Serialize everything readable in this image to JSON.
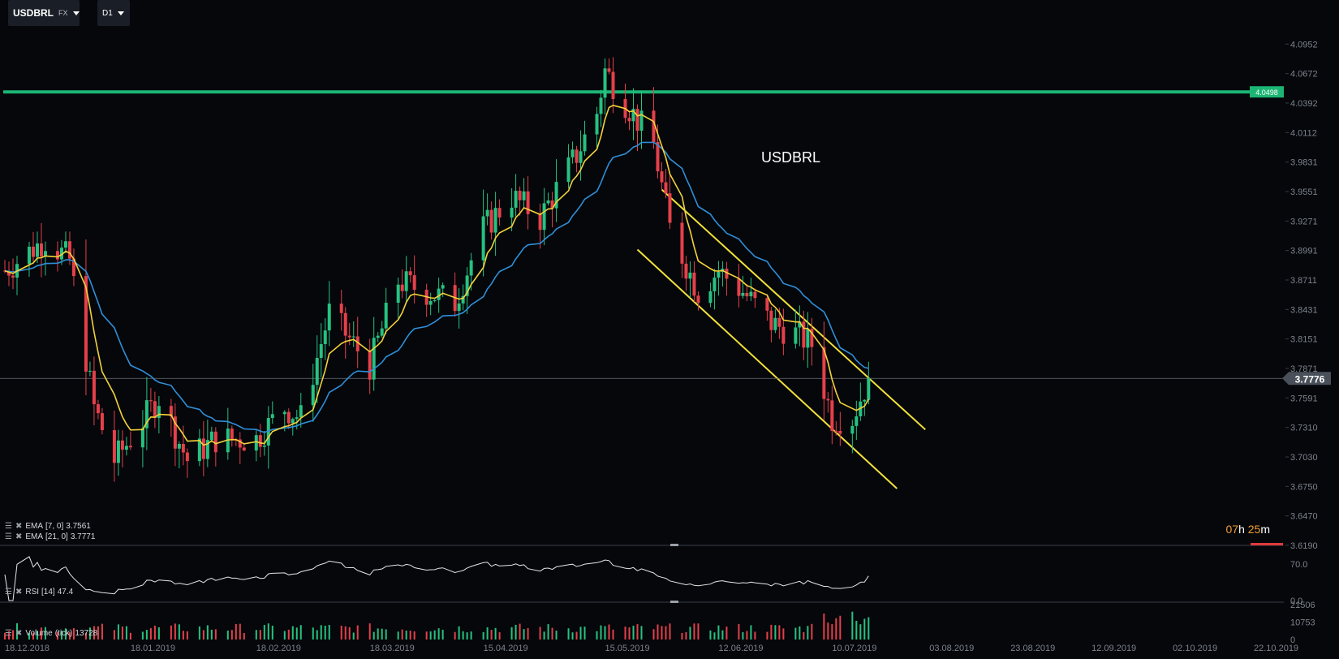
{
  "toolbar": {
    "symbol": "USDBRL",
    "market": "FX",
    "timeframe": "D1"
  },
  "chart_title": "USDBRL",
  "legends": {
    "ema7": {
      "label": "EMA",
      "params": "[7, 0]",
      "value": "3.7561"
    },
    "ema21": {
      "label": "EMA",
      "params": "[21, 0]",
      "value": "3.7771"
    },
    "rsi": {
      "label": "RSI",
      "params": "[14]",
      "value": "47.4"
    },
    "volume": {
      "label": "Volume",
      "params": "(tick)",
      "value": "13728"
    }
  },
  "countdown": {
    "hours": "07",
    "h_unit": "h",
    "minutes": "25",
    "m_unit": "m"
  },
  "colors": {
    "background": "#05070b",
    "bull": "#26c281",
    "bear": "#e5404a",
    "ema7": "#f3d23a",
    "ema21": "#2f8fd8",
    "channel": "#f3e23a",
    "resistance": "#1cb574",
    "grid_text": "#7d838c",
    "rsi_line": "#e6e6e6"
  },
  "chart_data": [
    {
      "type": "candlestick",
      "title": "USDBRL",
      "x_ticks": [
        "18.12.2018",
        "18.01.2019",
        "18.02.2019",
        "18.03.2019",
        "15.04.2019",
        "15.05.2019",
        "12.06.2019",
        "10.07.2019",
        "03.08.2019",
        "23.08.2019",
        "12.09.2019",
        "02.10.2019",
        "22.10.2019"
      ],
      "y_ticks": [
        "4.0952",
        "4.0672",
        "4.0392",
        "4.0112",
        "3.9831",
        "3.9551",
        "3.9271",
        "3.8991",
        "3.8711",
        "3.8431",
        "3.8151",
        "3.7871",
        "3.7591",
        "3.7310",
        "3.7030",
        "3.6750",
        "3.6470",
        "3.6190"
      ],
      "ylim": [
        3.619,
        4.1232
      ],
      "last_price": "3.7776",
      "resistance_level": "4.0498",
      "close_anchors": [
        [
          "18.12.2018",
          3.88
        ],
        [
          "28.12.2018",
          3.91
        ],
        [
          "03.01.2019",
          3.89
        ],
        [
          "09.01.2019",
          3.75
        ],
        [
          "14.01.2019",
          3.7
        ],
        [
          "18.01.2019",
          3.72
        ],
        [
          "25.01.2019",
          3.76
        ],
        [
          "01.02.2019",
          3.7
        ],
        [
          "08.02.2019",
          3.72
        ],
        [
          "18.02.2019",
          3.72
        ],
        [
          "25.02.2019",
          3.75
        ],
        [
          "01.03.2019",
          3.74
        ],
        [
          "08.03.2019",
          3.84
        ],
        [
          "18.03.2019",
          3.79
        ],
        [
          "25.03.2019",
          3.87
        ],
        [
          "01.04.2019",
          3.86
        ],
        [
          "08.04.2019",
          3.85
        ],
        [
          "15.04.2019",
          3.92
        ],
        [
          "22.04.2019",
          3.95
        ],
        [
          "29.04.2019",
          3.93
        ],
        [
          "08.05.2019",
          3.99
        ],
        [
          "13.05.2019",
          4.03
        ],
        [
          "15.05.2019",
          4.07
        ],
        [
          "20.05.2019",
          4.04
        ],
        [
          "27.05.2019",
          4.0
        ],
        [
          "31.05.2019",
          3.92
        ],
        [
          "07.06.2019",
          3.86
        ],
        [
          "12.06.2019",
          3.88
        ],
        [
          "18.06.2019",
          3.86
        ],
        [
          "25.06.2019",
          3.83
        ],
        [
          "01.07.2019",
          3.82
        ],
        [
          "05.07.2019",
          3.81
        ],
        [
          "10.07.2019",
          3.74
        ],
        [
          "15.07.2019",
          3.74
        ],
        [
          "19.07.2019",
          3.7776
        ]
      ],
      "ema7_last": 3.7561,
      "ema21_last": 3.7771
    },
    {
      "type": "line",
      "title": "RSI [14]",
      "y_ticks": [
        "70.0",
        "0.0"
      ],
      "ylim": [
        0,
        100
      ],
      "last_value": 47.4
    },
    {
      "type": "bar",
      "title": "Volume (tick)",
      "y_ticks": [
        "21506",
        "10753",
        "0"
      ],
      "ylim": [
        0,
        21506
      ],
      "last_value": 13728
    }
  ]
}
